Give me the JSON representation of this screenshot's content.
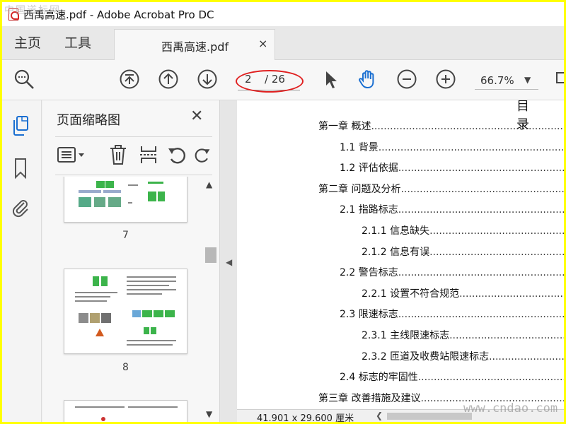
{
  "window": {
    "title": "西禹高速.pdf - Adobe Acrobat Pro DC"
  },
  "tabs": {
    "home": "主页",
    "tools": "工具",
    "document": "西禹高速.pdf",
    "close": "×"
  },
  "toolbar": {
    "page_current": "2",
    "page_total": "/ 26",
    "zoom": "66.7%",
    "highlight_color": "#e02020"
  },
  "thumbnails": {
    "title": "页面缩略图",
    "close": "✕",
    "pages": [
      {
        "number": "7"
      },
      {
        "number": "8"
      }
    ]
  },
  "toc": {
    "heading": "目 录",
    "entries": [
      {
        "label": "第一章  概述",
        "level": 0
      },
      {
        "label": "1.1  背景",
        "level": 1
      },
      {
        "label": "1.2 评估依据",
        "level": 1
      },
      {
        "label": "第二章   问题及分析",
        "level": 0
      },
      {
        "label": "2.1 指路标志",
        "level": 1
      },
      {
        "label": "2.1.1 信息缺失",
        "level": 2
      },
      {
        "label": "2.1.2 信息有误",
        "level": 2
      },
      {
        "label": "2.2 警告标志",
        "level": 1
      },
      {
        "label": "2.2.1 设置不符合规范",
        "level": 2
      },
      {
        "label": "2.3 限速标志",
        "level": 1
      },
      {
        "label": "2.3.1 主线限速标志",
        "level": 2
      },
      {
        "label": "2.3.2 匝道及收费站限速标志",
        "level": 2
      },
      {
        "label": "2.4 标志的牢固性",
        "level": 1
      },
      {
        "label": "第三章   改善措施及建议",
        "level": 0
      }
    ]
  },
  "status": {
    "dimensions": "41.901 x 29.600 厘米"
  },
  "watermarks": {
    "top_left": "中国道标网",
    "bottom_right": "www.cndao.com"
  }
}
